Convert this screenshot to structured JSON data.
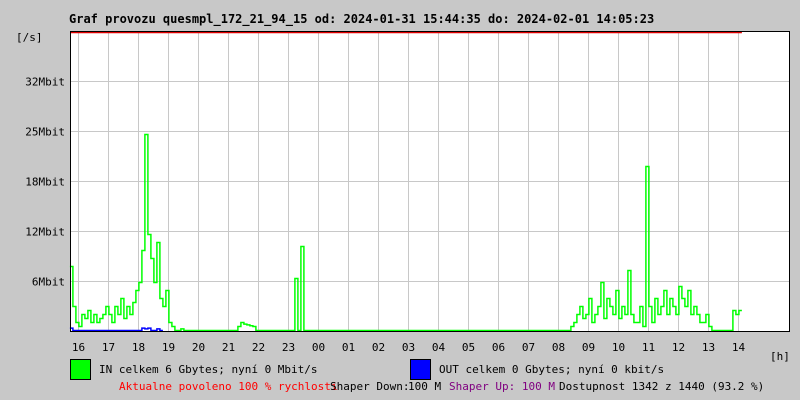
{
  "title": "Graf provozu quesmpl_172_21_94_15 od: 2024-01-31 15:44:35 do: 2024-02-01 14:05:23",
  "chart_data": {
    "type": "line",
    "title": "Graf provozu quesmpl_172_21_94_15 od: 2024-01-31 15:44:35 do: 2024-02-01 14:05:23",
    "ylabel": "[/s]",
    "xlabel": "[h]",
    "ylim": [
      0,
      37.5
    ],
    "yticks": [
      {
        "v": 6.25,
        "label": "6Mbit"
      },
      {
        "v": 12.5,
        "label": "12Mbit"
      },
      {
        "v": 18.75,
        "label": "18Mbit"
      },
      {
        "v": 25,
        "label": "25Mbit"
      },
      {
        "v": 31.25,
        "label": "32Mbit"
      }
    ],
    "xticks": [
      "16",
      "17",
      "18",
      "19",
      "20",
      "21",
      "22",
      "23",
      "00",
      "01",
      "02",
      "03",
      "04",
      "05",
      "06",
      "07",
      "08",
      "09",
      "10",
      "11",
      "12",
      "13",
      "14"
    ],
    "x_start_hours_before_16": 0.27,
    "bucket_minutes": 6,
    "limit_line_mbit": 37.5,
    "series": [
      {
        "name": "IN",
        "color": "#00ff00",
        "values": [
          8,
          3,
          1,
          0.5,
          2,
          1.5,
          2.5,
          1,
          2,
          1,
          1.5,
          2,
          3,
          2,
          1,
          3,
          2,
          4,
          1.5,
          3,
          2,
          3.5,
          5,
          6,
          10,
          24.5,
          12,
          9,
          6,
          11,
          4,
          3,
          5,
          1,
          0.5,
          0,
          0,
          0.2,
          0,
          0,
          0,
          0,
          0,
          0,
          0,
          0,
          0,
          0,
          0,
          0,
          0,
          0,
          0,
          0,
          0,
          0,
          0.5,
          1,
          0.8,
          0.7,
          0.6,
          0.5,
          0,
          0,
          0,
          0,
          0,
          0,
          0,
          0,
          0,
          0,
          0,
          0,
          0,
          6.5,
          0,
          10.5,
          0,
          0,
          0,
          0,
          0,
          0,
          0,
          0,
          0,
          0,
          0,
          0,
          0,
          0,
          0,
          0,
          0,
          0,
          0,
          0,
          0,
          0,
          0,
          0,
          0,
          0,
          0,
          0,
          0,
          0,
          0,
          0,
          0,
          0,
          0,
          0,
          0,
          0,
          0,
          0,
          0,
          0,
          0,
          0,
          0,
          0,
          0,
          0,
          0,
          0,
          0,
          0,
          0,
          0,
          0,
          0,
          0,
          0,
          0,
          0,
          0,
          0,
          0,
          0,
          0,
          0,
          0,
          0,
          0,
          0,
          0,
          0,
          0,
          0,
          0,
          0,
          0,
          0,
          0,
          0,
          0,
          0,
          0,
          0,
          0,
          0,
          0,
          0,
          0,
          0.5,
          1,
          2,
          3,
          1.5,
          2,
          4,
          1,
          2,
          3,
          6,
          1.5,
          4,
          3,
          2,
          5,
          1.5,
          3,
          2,
          7.5,
          2,
          1,
          1,
          3,
          0.5,
          20.5,
          3,
          1,
          4,
          2,
          3,
          5,
          2,
          4,
          3,
          2,
          5.5,
          4,
          3,
          5,
          2,
          3,
          2,
          1,
          1,
          2,
          0.5,
          0,
          0,
          0,
          0,
          0,
          0,
          0,
          2.5,
          2,
          2.5
        ]
      },
      {
        "name": "OUT",
        "color": "#0000ff",
        "values": [
          0.3,
          0,
          0,
          0,
          0,
          0,
          0,
          0,
          0,
          0,
          0,
          0,
          0,
          0,
          0,
          0,
          0,
          0,
          0,
          0,
          0,
          0,
          0,
          0,
          0.3,
          0.2,
          0.3,
          0,
          0,
          0.2,
          0
        ]
      }
    ],
    "legend": [
      {
        "label": "IN celkem 6 Gbytes; nyní 0 Mbit/s",
        "color": "#00ff00"
      },
      {
        "label": "OUT celkem 0 Gbytes; nyní 0 kbit/s",
        "color": "#0000ff"
      }
    ]
  },
  "footer": {
    "allowed": "Aktualne povoleno 100 % rychlosti",
    "shaper_down_label": "Shaper Down:",
    "shaper_down_value": "100 M",
    "shaper_up": "Shaper Up: 100 M",
    "availability": "Dostupnost 1342 z 1440 (93.2 %)"
  }
}
